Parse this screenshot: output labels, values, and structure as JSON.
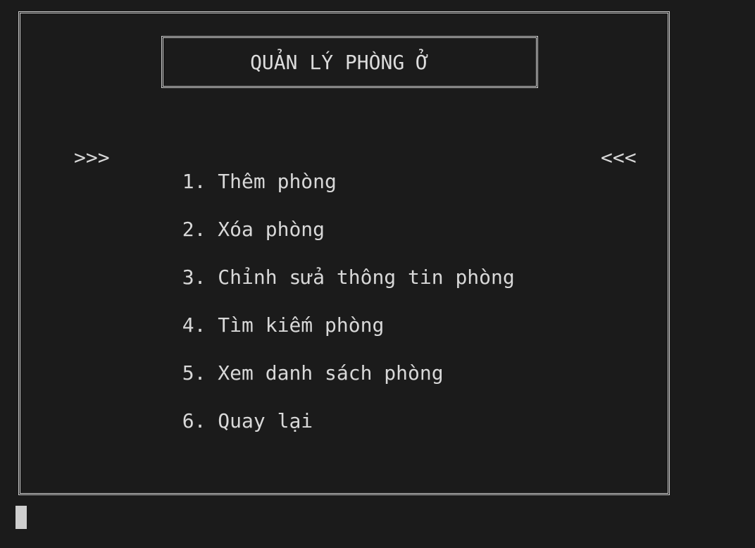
{
  "title": "QUẢN LÝ PHÒNG Ở",
  "selector": {
    "left": ">>>",
    "right": "<<<"
  },
  "menu": [
    {
      "number": "1.",
      "label": "Thêm phòng",
      "selected": true
    },
    {
      "number": "2.",
      "label": "Xóa phòng",
      "selected": false
    },
    {
      "number": "3.",
      "label": "Chỉnh sửa thông tin phòng",
      "selected": false
    },
    {
      "number": "4.",
      "label": "Tìm kiếm phòng",
      "selected": false
    },
    {
      "number": "5.",
      "label": "Xem danh sách phòng",
      "selected": false
    },
    {
      "number": "6.",
      "label": "Quay lại",
      "selected": false
    }
  ]
}
